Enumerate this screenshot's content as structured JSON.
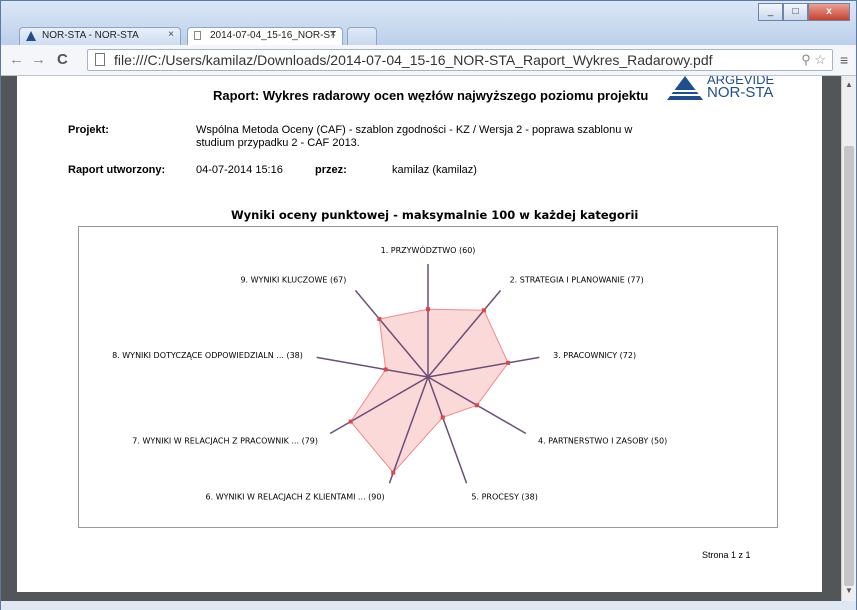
{
  "browser": {
    "tabs": [
      {
        "label": "NOR-STA - NOR-STA"
      },
      {
        "label": "2014-07-04_15-16_NOR-ST"
      }
    ],
    "url": "file:///C:/Users/kamilaz/Downloads/2014-07-04_15-16_NOR-STA_Raport_Wykres_Radarowy.pdf"
  },
  "report": {
    "title": "Raport: Wykres radarowy ocen węzłów najwyższego poziomu projektu",
    "logo_line1": "ARGEVIDE",
    "logo_line2": "NOR-STA",
    "project_label": "Projekt:",
    "project_value_line1": "Wspólna Metoda Oceny (CAF) - szablon zgodności - KZ / Wersja 2 - poprawa szablonu w",
    "project_value_line2": "studium przypadku 2 - CAF 2013.",
    "created_label": "Raport utworzony:",
    "created_value": "04-07-2014 15:16",
    "by_label": "przez:",
    "by_value": "kamilaz (kamilaz)",
    "page_footer": "Strona 1 z 1"
  },
  "chart_data": {
    "type": "radar",
    "title": "Wyniki oceny punktowej - maksymalnie 100 w każdej kategorii",
    "max": 100,
    "categories": [
      "1. PRZYWÓDZTWO (60)",
      "2. STRATEGIA I PLANOWANIE (77)",
      "3. PRACOWNICY (72)",
      "4. PARTNERSTWO I ZASOBY (50)",
      "5. PROCESY (38)",
      "6. WYNIKI W RELACJACH Z KLIENTAMI ... (90)",
      "7. WYNIKI W RELACJACH Z PRACOWNIK ... (79)",
      "8. WYNIKI DOTYCZĄCE ODPOWIEDZIALN ... (38)",
      "9. WYNIKI KLUCZOWE (67)"
    ],
    "values": [
      60,
      77,
      72,
      50,
      38,
      90,
      79,
      38,
      67
    ],
    "colors": {
      "fill": "#f9c9c9",
      "stroke": "#f08a8a",
      "point": "#e04545",
      "spoke": "#6b4e7a"
    }
  }
}
